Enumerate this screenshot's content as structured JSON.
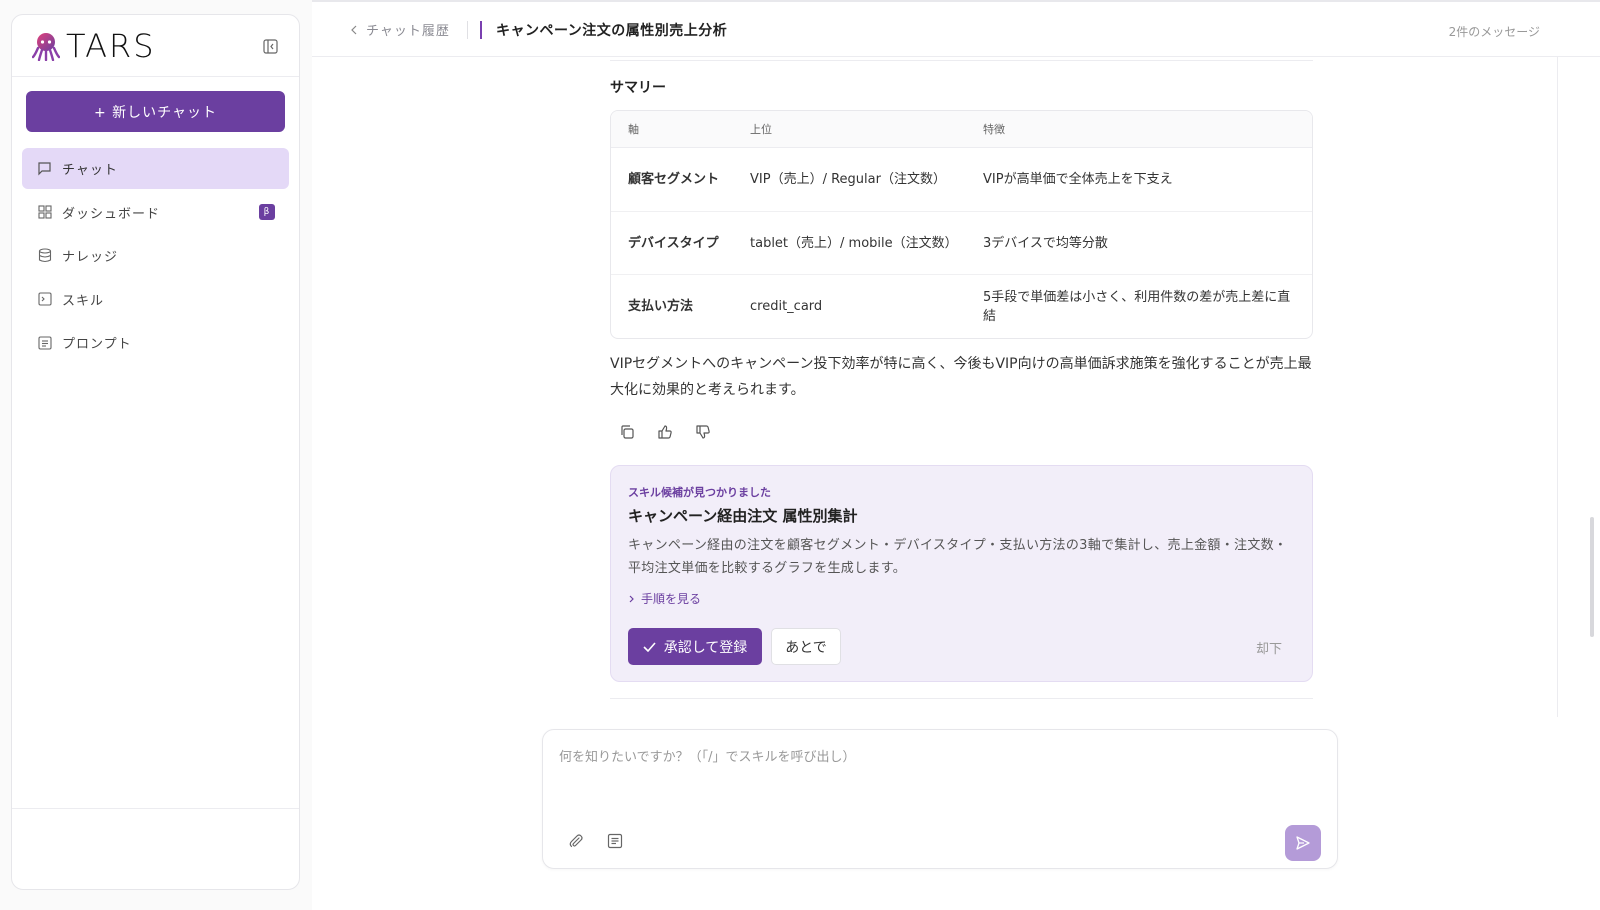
{
  "sidebar": {
    "logo_text": "TARS",
    "new_chat_label": "+ 新しいチャット",
    "items": [
      {
        "label": "チャット",
        "icon": "chat-icon",
        "active": true
      },
      {
        "label": "ダッシュボード",
        "icon": "dashboard-icon",
        "badge": "β"
      },
      {
        "label": "ナレッジ",
        "icon": "database-icon"
      },
      {
        "label": "スキル",
        "icon": "terminal-icon"
      },
      {
        "label": "プロンプト",
        "icon": "prompt-icon"
      }
    ]
  },
  "header": {
    "breadcrumb": "チャット履歴",
    "title": "キャンペーン注文の属性別売上分析",
    "message_count": "2件のメッセージ"
  },
  "summary": {
    "heading": "サマリー",
    "columns": [
      "軸",
      "上位",
      "特徴"
    ],
    "rows": [
      [
        "顧客セグメント",
        "VIP（売上）/ Regular（注文数）",
        "VIPが高単価で全体売上を下支え"
      ],
      [
        "デバイスタイプ",
        "tablet（売上）/ mobile（注文数）",
        "3デバイスで均等分散"
      ],
      [
        "支払い方法",
        "credit_card",
        "5手段で単価差は小さく、利用件数の差が売上差に直結"
      ]
    ]
  },
  "conclusion": "VIPセグメントへのキャンペーン投下効率が特に高く、今後もVIP向けの高単価訴求施策を強化することが売上最大化に効果的と考えられます。",
  "skill_card": {
    "tag": "スキル候補が見つかりました",
    "title": "キャンペーン経由注文 属性別集計",
    "description": "キャンペーン経由の注文を顧客セグメント・デバイスタイプ・支払い方法の3軸で集計し、売上金額・注文数・平均注文単価を比較するグラフを生成します。",
    "steps_label": "手順を見る",
    "approve_label": "承認して登録",
    "later_label": "あとで",
    "reject_label": "却下"
  },
  "composer": {
    "placeholder": "何を知りたいですか？（「/」でスキルを呼び出し）"
  },
  "colors": {
    "accent": "#6b3fa0",
    "active_bg": "#e4d9f7",
    "card_bg": "#f2eef9",
    "send_bg": "#b49bd8"
  }
}
